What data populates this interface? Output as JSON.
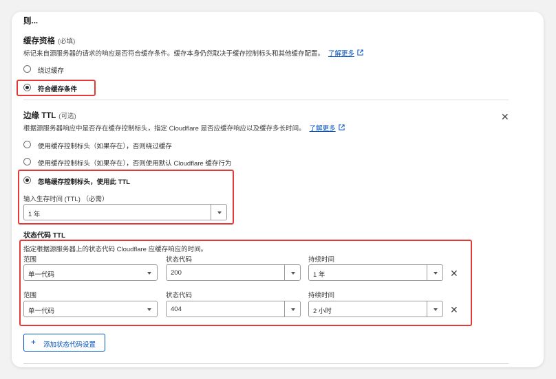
{
  "section_top": {
    "title": "则..."
  },
  "cache_eligibility": {
    "title": "缓存资格",
    "required": "(必填)",
    "description": "标记来自源服务器的请求的响应是否符合缓存条件。缓存本身仍然取决于缓存控制标头和其他缓存配置。",
    "learn_more": "了解更多",
    "options": [
      {
        "label": "绕过缓存",
        "selected": false
      },
      {
        "label": "符合缓存条件",
        "selected": true
      }
    ]
  },
  "edge_ttl": {
    "title": "边缘 TTL",
    "optional": "(可选)",
    "description": "根据源服务器响应中是否存在缓存控制标头，指定 Cloudflare 是否应缓存响应以及缓存多长时间。",
    "learn_more": "了解更多",
    "options": [
      {
        "label": "使用缓存控制标头（如果存在），否则绕过缓存",
        "selected": false
      },
      {
        "label": "使用缓存控制标头（如果存在），否则使用默认 Cloudflare 缓存行为",
        "selected": false
      },
      {
        "label": "忽略缓存控制标头，使用此 TTL",
        "selected": true
      }
    ],
    "ttl_input_label": "输入生存时间 (TTL) （必需）",
    "ttl_value": "1 年"
  },
  "status_code_ttl": {
    "title": "状态代码 TTL",
    "description": "指定根据源服务器上的状态代码 Cloudflare 应缓存响应的时间。",
    "column_labels": {
      "range": "范围",
      "code": "状态代码",
      "duration": "持续时间"
    },
    "rows": [
      {
        "range": "单一代码",
        "code": "200",
        "duration": "1 年"
      },
      {
        "range": "单一代码",
        "code": "404",
        "duration": "2 小时"
      }
    ],
    "add_button": "添加状态代码设置"
  },
  "colors": {
    "highlight": "#e53935",
    "link": "#0051c3"
  },
  "icons": [
    "external-link-icon",
    "close-icon",
    "chevron-down-icon",
    "plus-icon",
    "radio-icon"
  ]
}
